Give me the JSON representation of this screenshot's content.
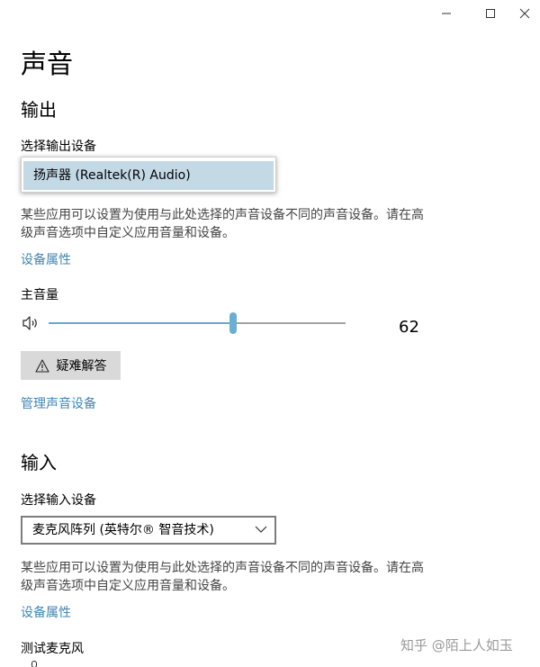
{
  "window": {
    "minimize_icon": "minimize-icon",
    "maximize_icon": "maximize-icon",
    "close_icon": "close-icon"
  },
  "page": {
    "title": "声音"
  },
  "output": {
    "heading": "输出",
    "select_label": "选择输出设备",
    "selected_device": "扬声器 (Realtek(R) Audio)",
    "description_line1": "某些应用可以设置为使用与此处选择的声音设备不同的声音设备。请在高",
    "description_line2": "级声音选项中自定义应用音量和设备。",
    "device_properties_link": "设备属性",
    "master_volume_label": "主音量",
    "volume_value": "62",
    "volume_level": 62,
    "troubleshoot_label": "疑难解答",
    "manage_devices_link": "管理声音设备"
  },
  "input": {
    "heading": "输入",
    "select_label": "选择输入设备",
    "selected_device": "麦克风阵列 (英特尔® 智音技术)",
    "description_line1": "某些应用可以设置为使用与此处选择的声音设备不同的声音设备。请在高",
    "description_line2": "级声音选项中自定义应用音量和设备。",
    "device_properties_link": "设备属性",
    "test_mic_label": "测试麦克风"
  },
  "watermark": "知乎 @陌上人如玉",
  "colors": {
    "accent": "#6aaed3",
    "link": "#3f86b5",
    "dropdown_highlight": "#c3d9e6",
    "button_bg": "#d9d9d9"
  }
}
